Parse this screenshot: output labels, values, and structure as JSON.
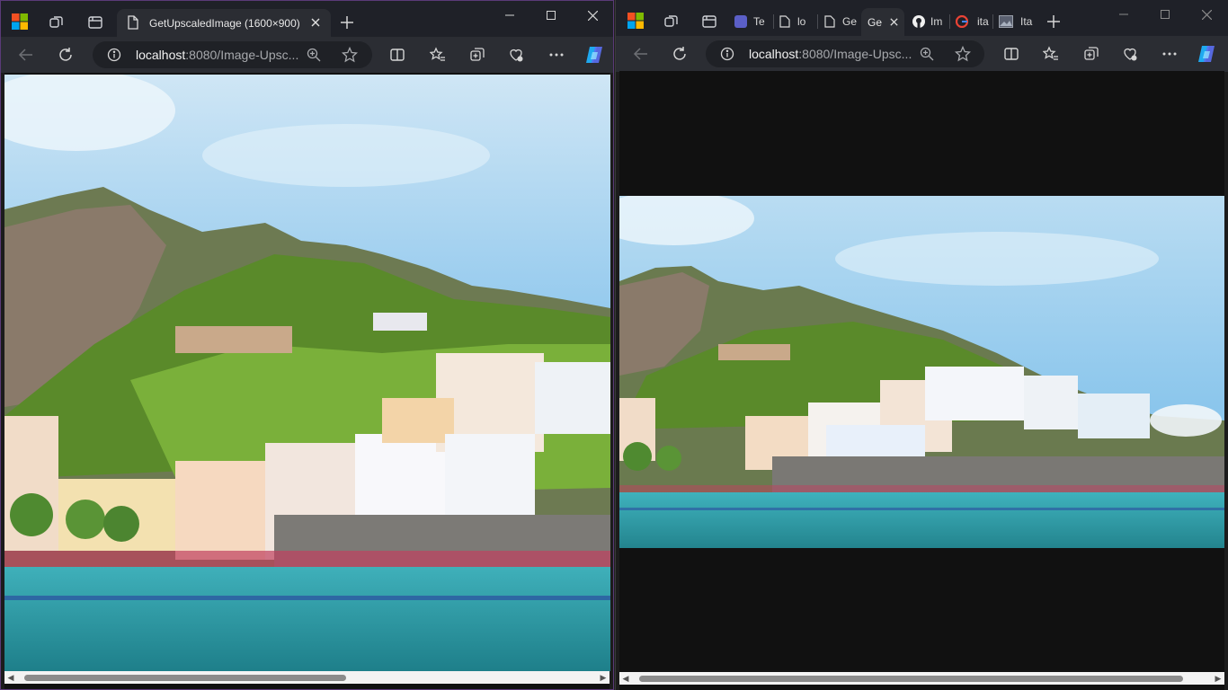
{
  "left": {
    "tab_title": "GetUpscaledImage (1600×900)",
    "url_host": "localhost",
    "url_rest": ":8080/Image-Upsc...",
    "scroll_left": "◀",
    "scroll_right": "▶"
  },
  "right": {
    "tabs": [
      {
        "label": "Te",
        "icon": "teams-icon"
      },
      {
        "label": "lo",
        "icon": "page-icon"
      },
      {
        "label": "Ge",
        "icon": "page-icon"
      },
      {
        "label": "Ge",
        "icon": "page-icon",
        "active": true
      },
      {
        "label": "Im",
        "icon": "github-icon"
      },
      {
        "label": "ita",
        "icon": "google-icon"
      },
      {
        "label": "Ita",
        "icon": "image-icon"
      }
    ],
    "url_host": "localhost",
    "url_rest": ":8080/Image-Upsc...",
    "scroll_left": "◀",
    "scroll_right": "▶"
  },
  "colors": {
    "accent_border": "#5a3a78",
    "sky": "#86c3ec",
    "sea": "#2a9aa6"
  }
}
